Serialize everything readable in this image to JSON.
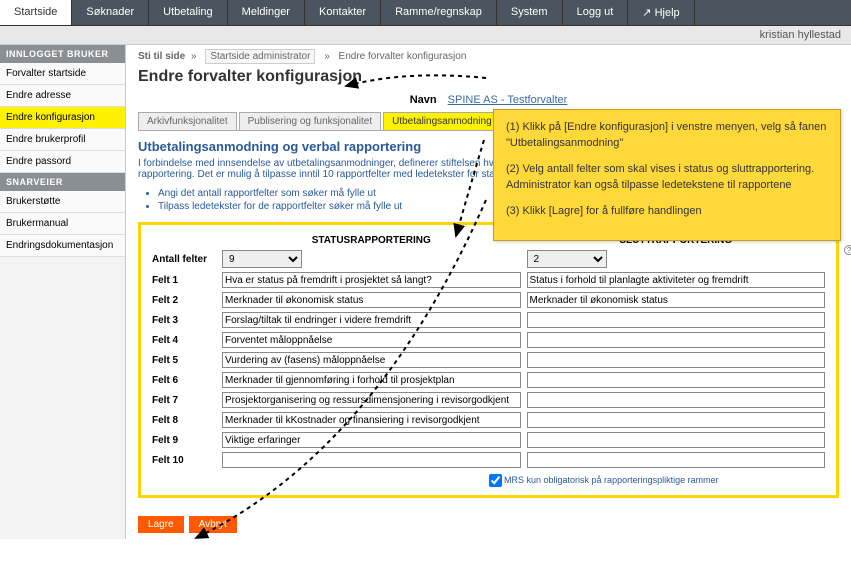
{
  "topnav": [
    "Startside",
    "Søknader",
    "Utbetaling",
    "Meldinger",
    "Kontakter",
    "Ramme/regnskap",
    "System",
    "Logg ut",
    "↗ Hjelp"
  ],
  "topnav_active": 0,
  "user": "kristian hyllestad",
  "sidebar": {
    "hdr1": "INNLOGGET BRUKER",
    "group1": [
      "Forvalter startside",
      "Endre adresse",
      "Endre konfigurasjon",
      "Endre brukerprofil",
      "Endre passord"
    ],
    "group1_active": 2,
    "hdr2": "SNARVEIER",
    "group2": [
      "Brukerstøtte",
      "Brukermanual",
      "Endringsdokumentasjon"
    ]
  },
  "breadcrumb": {
    "label": "Sti til side",
    "items": [
      "Startside administrator",
      "Endre forvalter konfigurasjon"
    ],
    "sep": "»"
  },
  "page_title": "Endre forvalter konfigurasjon",
  "navn": {
    "label": "Navn",
    "value": "SPINE AS - Testforvalter"
  },
  "subtabs": {
    "items": [
      "Arkivfunksjonalitet",
      "Publisering og funksjonalitet",
      "Utbetalingsanmodning"
    ],
    "active": 2
  },
  "section": {
    "title": "Utbetalingsanmodning og verbal rapportering",
    "desc": "I forbindelse med innsendelse av utbetalingsanmodninger, definerer stiftelsen hva som skal rapporteres i rapportering. Det er mulig å tilpasse inntil 10 rapportfelter med ledetekster for status- og sluttrapportering.",
    "bullets": [
      "Angi det antall rapportfelter som søker må fylle ut",
      "Tilpass ledetekster for de rapportfelter søker må fylle ut"
    ]
  },
  "form": {
    "col1_header": "STATUSRAPPORTERING",
    "col2_header": "SLUTTRAPPORTERING",
    "antall_label": "Antall felter",
    "antall_status": "9",
    "antall_slutt": "2",
    "rows": [
      {
        "label": "Felt 1",
        "a": "Hva er status på fremdrift i prosjektet så langt?",
        "b": "Status i forhold til planlagte aktiviteter og fremdrift"
      },
      {
        "label": "Felt 2",
        "a": "Merknader til økonomisk status",
        "b": "Merknader til økonomisk status"
      },
      {
        "label": "Felt 3",
        "a": "Forslag/tiltak til endringer i videre fremdrift",
        "b": ""
      },
      {
        "label": "Felt 4",
        "a": "Forventet måloppnåelse",
        "b": ""
      },
      {
        "label": "Felt 5",
        "a": "Vurdering av (fasens) måloppnåelse",
        "b": ""
      },
      {
        "label": "Felt 6",
        "a": "Merknader til gjennomføring i forhold til prosjektplan",
        "b": ""
      },
      {
        "label": "Felt 7",
        "a": "Prosjektorganisering og ressursdimensjonering i revisorgodkjent",
        "b": ""
      },
      {
        "label": "Felt 8",
        "a": "Merknader til kKostnader og finansiering i revisorgodkjent",
        "b": ""
      },
      {
        "label": "Felt 9",
        "a": "Viktige erfaringer",
        "b": ""
      },
      {
        "label": "Felt 10",
        "a": "",
        "b": ""
      }
    ],
    "checkbox_label": "MRS kun obligatorisk på rapporteringspliktige rammer",
    "checkbox_checked": true
  },
  "actions": {
    "save": "Lagre",
    "cancel": "Avbryt"
  },
  "callout": {
    "p1": "(1) Klikk på [Endre konfigurasjon] i venstre menyen, velg så fanen \"Utbetalingsanmodning\"",
    "p2": "(2) Velg antall felter som skal vises i status og sluttrapportering. Administrator kan også tilpasse ledetekstene til rapportene",
    "p3": "(3) Klikk [Lagre] for å fullføre handlingen"
  }
}
